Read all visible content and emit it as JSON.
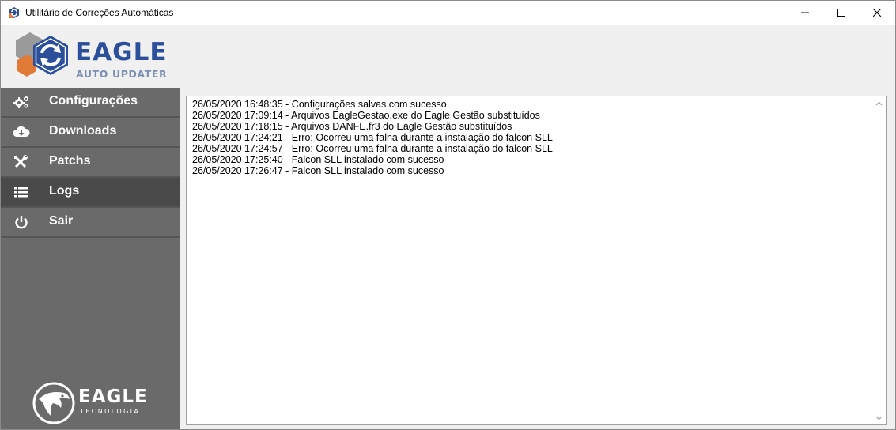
{
  "window": {
    "title": "Utilitário de Correções Automáticas"
  },
  "brand": {
    "name": "EAGLE",
    "subtitle": "AUTO UPDATER",
    "footer_name": "EAGLE",
    "footer_subtitle": "TECNOLOGIA"
  },
  "sidebar": {
    "items": [
      {
        "label": "Configurações",
        "icon": "gears-icon"
      },
      {
        "label": "Downloads",
        "icon": "cloud-download-icon"
      },
      {
        "label": "Patchs",
        "icon": "tools-icon"
      },
      {
        "label": "Logs",
        "icon": "list-icon",
        "active": true
      },
      {
        "label": "Sair",
        "icon": "power-icon"
      }
    ]
  },
  "logs": {
    "lines": [
      "26/05/2020 16:48:35 - Configurações salvas com sucesso.",
      "26/05/2020 17:09:14 - Arquivos EagleGestao.exe do Eagle Gestão substituídos",
      "26/05/2020 17:18:15 - Arquivos DANFE.fr3 do Eagle Gestão substituídos",
      "26/05/2020 17:24:21 - Erro: Ocorreu uma falha durante a instalação do falcon SLL",
      "26/05/2020 17:24:57 - Erro: Ocorreu uma falha durante a instalação do falcon SLL",
      "26/05/2020 17:25:40 - Falcon SLL instalado com sucesso",
      "26/05/2020 17:26:47 - Falcon SLL instalado com sucesso"
    ]
  },
  "colors": {
    "brand_blue": "#2b4f9b",
    "brand_orange": "#e07a36",
    "sidebar_bg": "#6a6a6a",
    "sidebar_active": "#4a4a4a"
  }
}
